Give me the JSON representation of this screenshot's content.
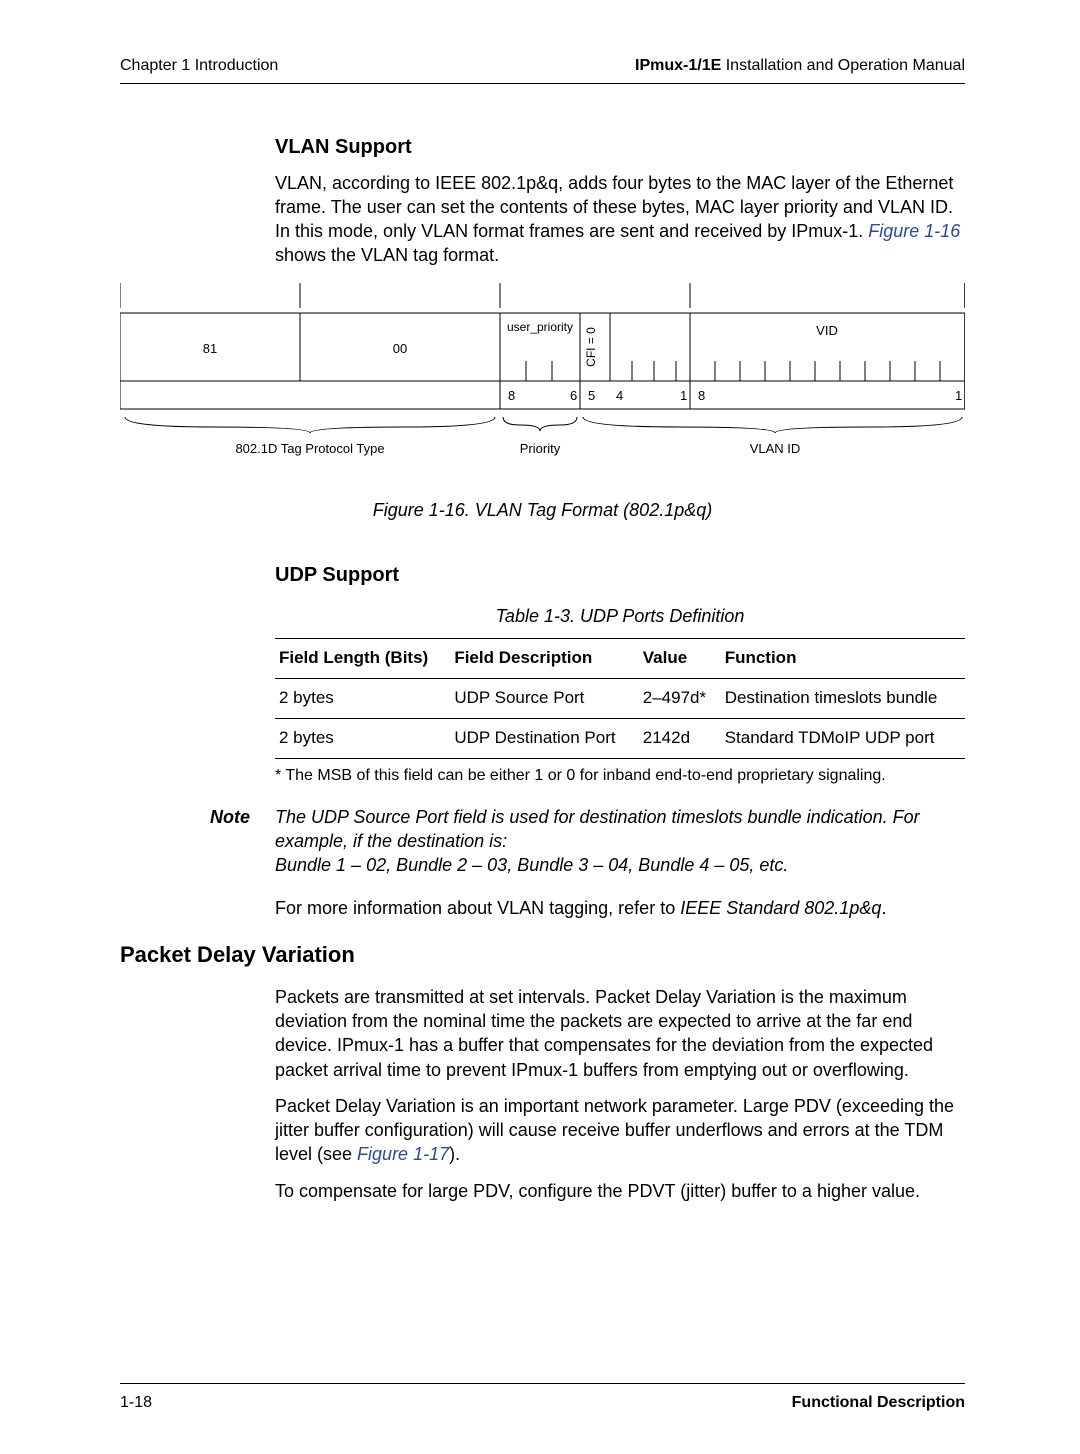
{
  "header": {
    "left": "Chapter 1  Introduction",
    "right_bold": "IPmux-1/1E",
    "right_rest": " Installation and Operation Manual"
  },
  "vlan": {
    "title": "VLAN Support",
    "para_pre": "VLAN, according to IEEE 802.1p&q, adds four bytes to the MAC layer of the Ethernet frame. The user can set the contents of these bytes, MAC layer priority and VLAN ID. In this mode, only VLAN format frames are sent and received by IPmux-1. ",
    "figref": "Figure 1-16",
    "para_post": " shows the VLAN tag format.",
    "caption": "Figure 1-16.  VLAN Tag Format (802.1p&q)"
  },
  "diagram": {
    "field81": "81",
    "field00": "00",
    "user_priority": "user_priority",
    "cfi": "CFI = 0",
    "vid": "VID",
    "bits": {
      "b8a": "8",
      "b6": "6",
      "b5": "5",
      "b4": "4",
      "b1a": "1",
      "b8b": "8",
      "b1b": "1"
    },
    "bottom_labels": {
      "proto": "802.1D Tag Protocol Type",
      "prio": "Priority",
      "vlanid": "VLAN ID"
    }
  },
  "udp": {
    "title": "UDP Support",
    "caption": "Table 1-3.  UDP Ports Definition",
    "headers": {
      "c1": "Field Length (Bits)",
      "c2": "Field Description",
      "c3": "Value",
      "c4": "Function"
    },
    "rows": [
      {
        "c1": "2 bytes",
        "c2": "UDP Source Port",
        "c3": "2–497d*",
        "c4": "Destination timeslots bundle"
      },
      {
        "c1": "2 bytes",
        "c2": "UDP Destination Port",
        "c3": "2142d",
        "c4": "Standard TDMoIP UDP port"
      }
    ],
    "footnote": "* The MSB of this field can be either 1 or 0 for inband end-to-end proprietary signaling.",
    "note_label": "Note",
    "note_body": "The UDP Source Port field is used for destination timeslots bundle indication. For example, if the destination is:\nBundle 1 – 02, Bundle 2 – 03, Bundle 3 – 04, Bundle 4 – 05, etc.",
    "more_pre": "For more information about VLAN tagging, refer to ",
    "more_ref": "IEEE Standard 802.1p&q",
    "more_post": "."
  },
  "pdv": {
    "title": "Packet Delay Variation",
    "p1": "Packets are transmitted at set intervals. Packet Delay Variation is the maximum deviation from the nominal time the packets are expected to arrive at the far end device. IPmux-1 has a buffer that compensates for the deviation from the expected packet arrival time to prevent IPmux-1 buffers from emptying out or overflowing.",
    "p2_pre": "Packet Delay Variation is an important network parameter. Large PDV (exceeding the jitter buffer configuration) will cause receive buffer underflows and errors at the TDM level (see ",
    "p2_ref": "Figure 1-17",
    "p2_post": ").",
    "p3": "To compensate for large PDV, configure the PDVT (jitter) buffer to a higher value."
  },
  "footer": {
    "left": "1-18",
    "right": "Functional Description"
  }
}
